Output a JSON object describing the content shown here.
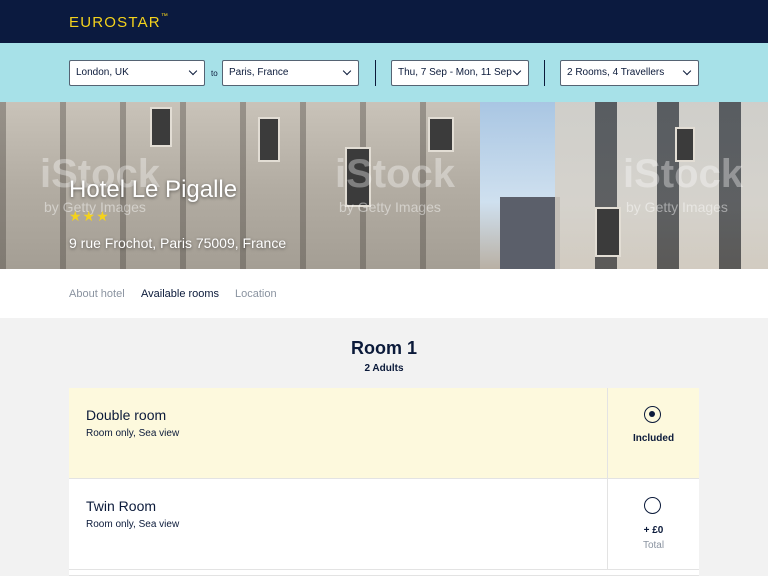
{
  "header": {
    "logo": "EUROSTAR",
    "logo_tm": "™"
  },
  "search": {
    "origin": "London, UK",
    "to_label": "to",
    "destination": "Paris, France",
    "dates": "Thu, 7 Sep - Mon, 11 Sep",
    "rooms": "2 Rooms, 4 Travellers"
  },
  "hotel": {
    "name": "Hotel Le Pigalle",
    "stars": "★★★",
    "rating": 3,
    "address": "9 rue Frochot, Paris 75009, France",
    "watermark": "iStock",
    "watermark_sub": "by Getty Images"
  },
  "tabs": [
    {
      "label": "About hotel",
      "active": false
    },
    {
      "label": "Available rooms",
      "active": true
    },
    {
      "label": "Location",
      "active": false
    }
  ],
  "room": {
    "title": "Room 1",
    "occupants": "2 Adults",
    "options": [
      {
        "name": "Double room",
        "desc": "Room only, Sea view",
        "price": "Included",
        "price_note": "",
        "selected": true
      },
      {
        "name": "Twin Room",
        "desc": "Room only, Sea view",
        "price": "+ £0",
        "price_note": "Total",
        "selected": false
      }
    ]
  },
  "colors": {
    "navy": "#0b1a3f",
    "accent_yellow": "#f4d21c",
    "search_bg": "#a7e1e8",
    "selected_bg": "#fdf9dd"
  }
}
